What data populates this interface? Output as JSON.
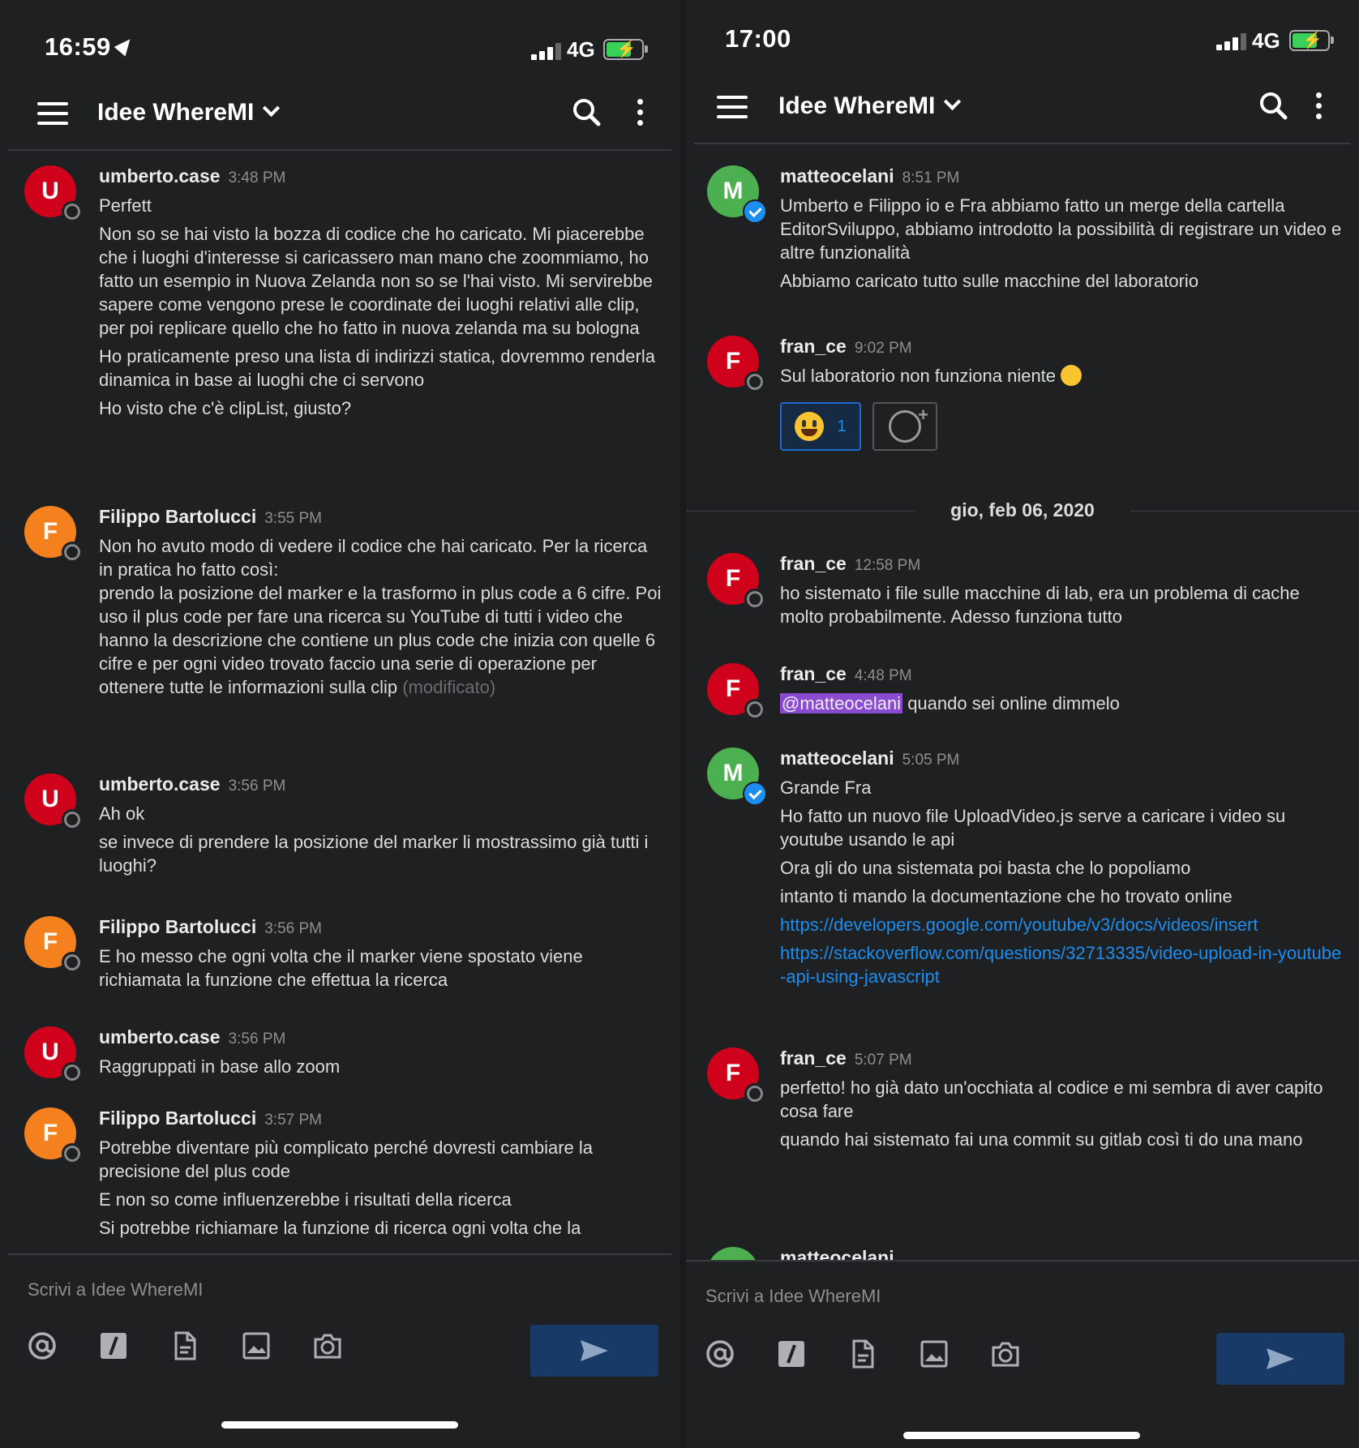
{
  "left": {
    "status": {
      "time": "16:59",
      "network": "4G"
    },
    "header": {
      "title": "Idee WhereMI"
    },
    "messages": [
      {
        "initial": "U",
        "user": "umberto.case",
        "time": "3:48 PM",
        "lines": [
          "Perfett",
          "Non so se hai visto la bozza di codice che ho caricato. Mi piacerebbe che i luoghi d'interesse si caricassero man mano che zoommiamo, ho fatto un esempio in Nuova Zelanda non so se l'hai visto. Mi servirebbe sapere come vengono prese le coordinate dei luoghi relativi alle clip, per poi replicare quello che ho fatto in nuova zelanda ma su bologna",
          "Ho praticamente preso una lista di indirizzi statica, dovremmo renderla dinamica in base ai luoghi che ci servono",
          "Ho visto che c'è clipList, giusto?"
        ]
      },
      {
        "initial": "F",
        "user": "Filippo Bartolucci",
        "time": "3:55 PM",
        "lines": [
          "Non ho avuto modo di vedere il codice che hai caricato. Per la ricerca in pratica ho fatto così:\nprendo la posizione del marker e la trasformo in plus code a 6 cifre. Poi uso il plus code per fare una ricerca su YouTube di tutti i video che hanno la descrizione che contiene  un plus code che inizia con quelle 6 cifre e per ogni video trovato faccio una serie di operazione per ottenere tutte le informazioni sulla clip"
        ],
        "edited": "(modificato)"
      },
      {
        "initial": "U",
        "user": "umberto.case",
        "time": "3:56 PM",
        "lines": [
          "Ah ok",
          "se invece di prendere la posizione del marker li mostrassimo già tutti i luoghi?"
        ]
      },
      {
        "initial": "F",
        "user": "Filippo Bartolucci",
        "time": "3:56 PM",
        "lines": [
          "E ho messo che ogni volta che il marker viene spostato viene richiamata la funzione che effettua la ricerca"
        ]
      },
      {
        "initial": "U",
        "user": "umberto.case",
        "time": "3:56 PM",
        "lines": [
          "Raggruppati in base allo zoom"
        ]
      },
      {
        "initial": "F",
        "user": "Filippo Bartolucci",
        "time": "3:57 PM",
        "lines": [
          "Potrebbe diventare più complicato perché dovresti cambiare la precisione del plus code",
          "E non so come influenzerebbe i risultati della ricerca",
          "Si potrebbe richiamare la funzione di ricerca ogni volta che la"
        ]
      }
    ],
    "composer": {
      "placeholder": "Scrivi a Idee WhereMI"
    }
  },
  "right": {
    "status": {
      "time": "17:00",
      "network": "4G"
    },
    "header": {
      "title": "Idee WhereMI"
    },
    "messages": [
      {
        "initial": "M",
        "user": "matteocelani",
        "time": "8:51 PM",
        "lines": [
          "Umberto e Filippo io e Fra abbiamo fatto un merge della cartella EditorSviluppo, abbiamo introdotto la possibilità di registrare un video e altre funzionalità",
          "Abbiamo caricato tutto sulle macchine del laboratorio"
        ]
      },
      {
        "initial": "F",
        "user": "fran_ce",
        "time": "9:02 PM",
        "lines": [
          "Sul laboratorio non funziona niente"
        ],
        "reaction_count": "1"
      },
      {
        "initial": "F",
        "user": "fran_ce",
        "time": "12:58 PM",
        "lines": [
          "ho sistemato i file sulle macchine di lab, era un problema di cache molto probabilmente. Adesso funziona tutto"
        ]
      },
      {
        "initial": "F",
        "user": "fran_ce",
        "time": "4:48 PM",
        "mention": "@matteocelani",
        "lines": [
          " quando sei online dimmelo"
        ]
      },
      {
        "initial": "M",
        "user": "matteocelani",
        "time": "5:05 PM",
        "lines": [
          "Grande Fra",
          "Ho fatto un nuovo file UploadVideo.js serve a caricare i video su youtube usando le api",
          "Ora gli do una sistemata poi basta che lo popoliamo",
          "intanto ti mando la documentazione che ho trovato online"
        ],
        "links": [
          "https://developers.google.com/youtube/v3/docs/videos/insert",
          "https://stackoverflow.com/questions/32713335/video-upload-in-youtube-api-using-javascript"
        ]
      },
      {
        "initial": "F",
        "user": "fran_ce",
        "time": "5:07 PM",
        "lines": [
          "perfetto! ho già dato un'occhiata al codice e mi sembra di aver capito cosa fare",
          "quando hai sistemato fai una commit su gitlab così ti do una mano"
        ]
      },
      {
        "initial": "M",
        "user": "matteocelani",
        "time": "",
        "lines": []
      }
    ],
    "date_separator": "gio, feb 06, 2020",
    "composer": {
      "placeholder": "Scrivi a Idee WhereMI"
    }
  },
  "colors": {
    "background": "#1f2022",
    "link": "#1b8ef0",
    "mention": "#8a4bd1",
    "send": "#173a66"
  },
  "icons": [
    "menu-icon",
    "chevron-down-icon",
    "search-icon",
    "more-vertical-icon",
    "at-icon",
    "slash-icon",
    "file-icon",
    "image-icon",
    "camera-icon",
    "send-icon",
    "add-reaction-icon"
  ]
}
